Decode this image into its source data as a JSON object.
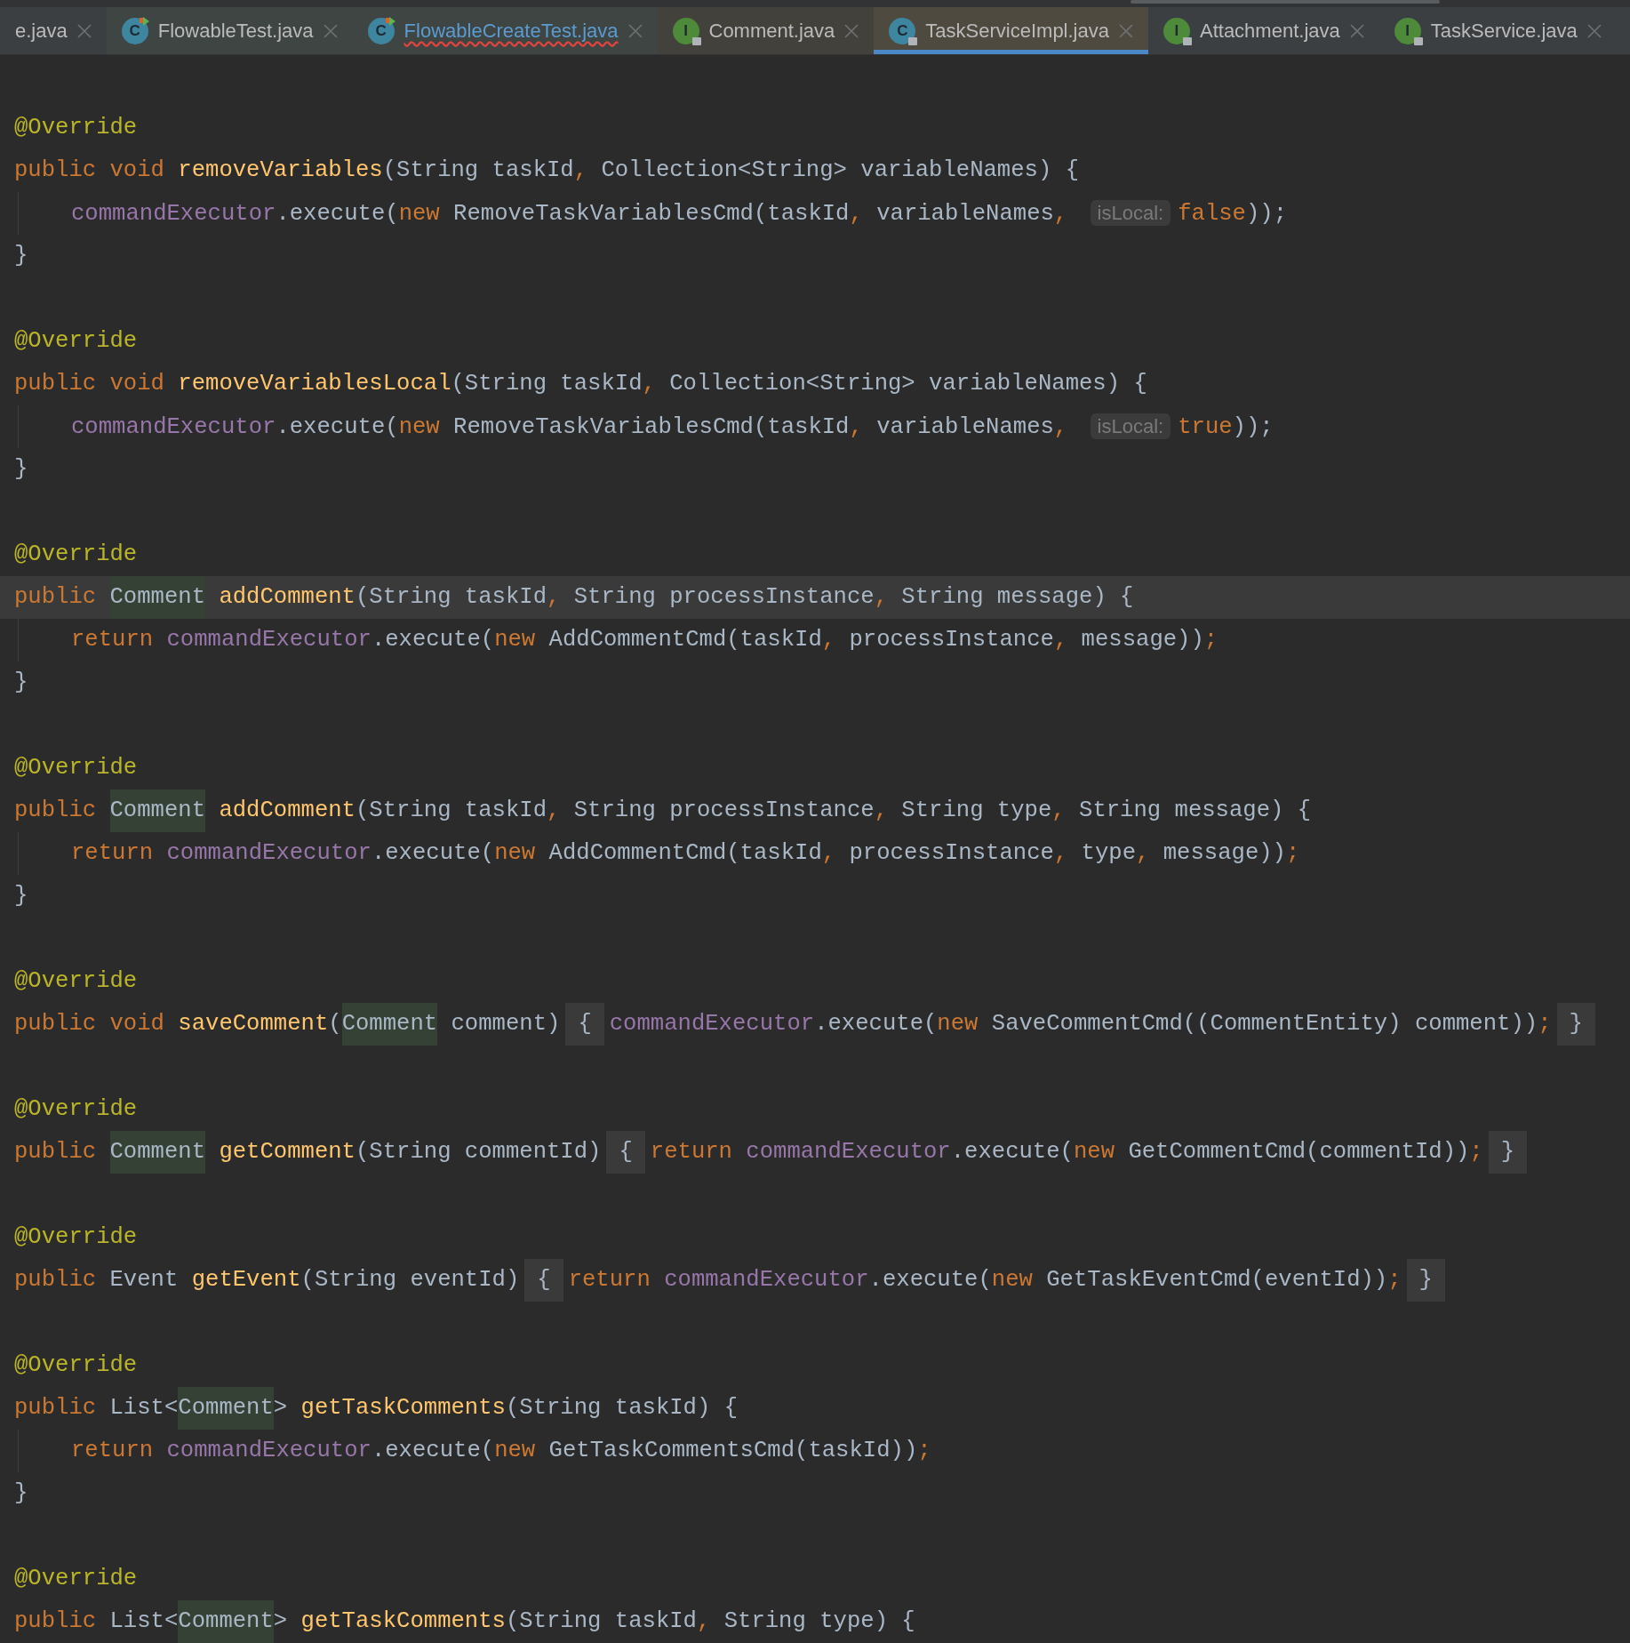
{
  "tabs": [
    {
      "label": "e.java",
      "color": "#3c3f41",
      "selected": false,
      "error": false
    },
    {
      "label": "FlowableTest.java",
      "letter": "C",
      "kind": "test",
      "color": "#3e4542",
      "selected": false,
      "error": false
    },
    {
      "label": "FlowableCreateTest.java",
      "letter": "C",
      "kind": "test",
      "color": "#3e4542",
      "selected": false,
      "error": true
    },
    {
      "label": "Comment.java",
      "letter": "I",
      "kind": "locked-interface",
      "color": "#43413c",
      "selected": false,
      "error": false
    },
    {
      "label": "TaskServiceImpl.java",
      "letter": "C",
      "kind": "locked-class",
      "color": "#4e4a3f",
      "selected": true,
      "error": false
    },
    {
      "label": "Attachment.java",
      "letter": "I",
      "kind": "locked-interface",
      "color": "#3c3f41",
      "selected": false,
      "error": false
    },
    {
      "label": "TaskService.java",
      "letter": "I",
      "kind": "locked-interface",
      "color": "#3c3f41",
      "selected": false,
      "error": false
    }
  ],
  "methods": [
    {
      "lines": [
        {
          "tokens": [
            {
              "text": "@Override",
              "kind": "ann"
            }
          ]
        },
        {
          "tokens": [
            {
              "text": "public void ",
              "kind": "kw"
            },
            {
              "text": "removeVariables",
              "kind": "fn"
            },
            {
              "text": "(String taskId",
              "kind": "plain"
            },
            {
              "text": ", ",
              "kind": "kw"
            },
            {
              "text": "Collection<String> variableNames) {",
              "kind": "plain"
            }
          ]
        },
        {
          "indented": true,
          "tokens": [
            {
              "text": "commandExecutor",
              "kind": "field"
            },
            {
              "text": ".execute(",
              "kind": "plain"
            },
            {
              "text": "new ",
              "kind": "kw"
            },
            {
              "text": "RemoveTaskVariablesCmd(taskId",
              "kind": "plain"
            },
            {
              "text": ", ",
              "kind": "kw"
            },
            {
              "text": "variableNames",
              "kind": "plain"
            },
            {
              "text": ", ",
              "kind": "kw"
            },
            {
              "text": "isLocal:",
              "kind": "hint"
            },
            {
              "text": "false",
              "kind": "kw"
            },
            {
              "text": "));",
              "kind": "plain"
            }
          ]
        },
        {
          "tokens": [
            {
              "text": "}",
              "kind": "plain"
            }
          ]
        }
      ]
    },
    {
      "lines": [
        {
          "tokens": [
            {
              "text": "@Override",
              "kind": "ann"
            }
          ]
        },
        {
          "tokens": [
            {
              "text": "public void ",
              "kind": "kw"
            },
            {
              "text": "removeVariablesLocal",
              "kind": "fn"
            },
            {
              "text": "(String taskId",
              "kind": "plain"
            },
            {
              "text": ", ",
              "kind": "kw"
            },
            {
              "text": "Collection<String> variableNames) {",
              "kind": "plain"
            }
          ]
        },
        {
          "indented": true,
          "tokens": [
            {
              "text": "commandExecutor",
              "kind": "field"
            },
            {
              "text": ".execute(",
              "kind": "plain"
            },
            {
              "text": "new ",
              "kind": "kw"
            },
            {
              "text": "RemoveTaskVariablesCmd(taskId",
              "kind": "plain"
            },
            {
              "text": ", ",
              "kind": "kw"
            },
            {
              "text": "variableNames",
              "kind": "plain"
            },
            {
              "text": ", ",
              "kind": "kw"
            },
            {
              "text": "isLocal:",
              "kind": "hint"
            },
            {
              "text": "true",
              "kind": "kw"
            },
            {
              "text": "));",
              "kind": "plain"
            }
          ]
        },
        {
          "tokens": [
            {
              "text": "}",
              "kind": "plain"
            }
          ]
        }
      ]
    },
    {
      "lines": [
        {
          "tokens": [
            {
              "text": "@Override",
              "kind": "ann"
            }
          ]
        },
        {
          "current": true,
          "tokens": [
            {
              "text": "public ",
              "kind": "kw"
            },
            {
              "text": "Comment",
              "kind": "usage"
            },
            {
              "text": " addComment",
              "kind": "fn"
            },
            {
              "text": "(String taskId",
              "kind": "plain"
            },
            {
              "text": ", ",
              "kind": "kw"
            },
            {
              "text": "String processInstance",
              "kind": "plain"
            },
            {
              "text": ", ",
              "kind": "kw"
            },
            {
              "text": "String message) {",
              "kind": "plain"
            }
          ]
        },
        {
          "indented": true,
          "tokens": [
            {
              "text": "return ",
              "kind": "kw"
            },
            {
              "text": "commandExecutor",
              "kind": "field"
            },
            {
              "text": ".execute(",
              "kind": "plain"
            },
            {
              "text": "new ",
              "kind": "kw"
            },
            {
              "text": "AddCommentCmd(taskId",
              "kind": "plain"
            },
            {
              "text": ", ",
              "kind": "kw"
            },
            {
              "text": "processInstance",
              "kind": "plain"
            },
            {
              "text": ", ",
              "kind": "kw"
            },
            {
              "text": "message))",
              "kind": "plain"
            },
            {
              "text": ";",
              "kind": "kw"
            }
          ]
        },
        {
          "tokens": [
            {
              "text": "}",
              "kind": "plain"
            }
          ]
        }
      ]
    },
    {
      "lines": [
        {
          "tokens": [
            {
              "text": "@Override",
              "kind": "ann"
            }
          ]
        },
        {
          "tokens": [
            {
              "text": "public ",
              "kind": "kw"
            },
            {
              "text": "Comment",
              "kind": "usage"
            },
            {
              "text": " addComment",
              "kind": "fn"
            },
            {
              "text": "(String taskId",
              "kind": "plain"
            },
            {
              "text": ", ",
              "kind": "kw"
            },
            {
              "text": "String processInstance",
              "kind": "plain"
            },
            {
              "text": ", ",
              "kind": "kw"
            },
            {
              "text": "String type",
              "kind": "plain"
            },
            {
              "text": ", ",
              "kind": "kw"
            },
            {
              "text": "String message) {",
              "kind": "plain"
            }
          ]
        },
        {
          "indented": true,
          "tokens": [
            {
              "text": "return ",
              "kind": "kw"
            },
            {
              "text": "commandExecutor",
              "kind": "field"
            },
            {
              "text": ".execute(",
              "kind": "plain"
            },
            {
              "text": "new ",
              "kind": "kw"
            },
            {
              "text": "AddCommentCmd(taskId",
              "kind": "plain"
            },
            {
              "text": ", ",
              "kind": "kw"
            },
            {
              "text": "processInstance",
              "kind": "plain"
            },
            {
              "text": ", ",
              "kind": "kw"
            },
            {
              "text": "type",
              "kind": "plain"
            },
            {
              "text": ", ",
              "kind": "kw"
            },
            {
              "text": "message))",
              "kind": "plain"
            },
            {
              "text": ";",
              "kind": "kw"
            }
          ]
        },
        {
          "tokens": [
            {
              "text": "}",
              "kind": "plain"
            }
          ]
        }
      ]
    },
    {
      "lines": [
        {
          "tokens": [
            {
              "text": "@Override",
              "kind": "ann"
            }
          ]
        },
        {
          "tokens": [
            {
              "text": "public void ",
              "kind": "kw"
            },
            {
              "text": "saveComment",
              "kind": "fn"
            },
            {
              "text": "(",
              "kind": "plain"
            },
            {
              "text": "Comment",
              "kind": "usage"
            },
            {
              "text": " comment)",
              "kind": "plain"
            },
            {
              "text": "{",
              "kind": "fold"
            },
            {
              "text": "commandExecutor",
              "kind": "field"
            },
            {
              "text": ".execute(",
              "kind": "plain"
            },
            {
              "text": "new ",
              "kind": "kw"
            },
            {
              "text": "SaveCommentCmd((CommentEntity) comment))",
              "kind": "plain"
            },
            {
              "text": ";",
              "kind": "kw"
            },
            {
              "text": "}",
              "kind": "fold"
            }
          ]
        }
      ]
    },
    {
      "lines": [
        {
          "tokens": [
            {
              "text": "@Override",
              "kind": "ann"
            }
          ]
        },
        {
          "tokens": [
            {
              "text": "public ",
              "kind": "kw"
            },
            {
              "text": "Comment",
              "kind": "usage"
            },
            {
              "text": " getComment",
              "kind": "fn"
            },
            {
              "text": "(String commentId)",
              "kind": "plain"
            },
            {
              "text": "{",
              "kind": "fold"
            },
            {
              "text": "return ",
              "kind": "kw"
            },
            {
              "text": "commandExecutor",
              "kind": "field"
            },
            {
              "text": ".execute(",
              "kind": "plain"
            },
            {
              "text": "new ",
              "kind": "kw"
            },
            {
              "text": "GetCommentCmd(commentId))",
              "kind": "plain"
            },
            {
              "text": ";",
              "kind": "kw"
            },
            {
              "text": "}",
              "kind": "fold"
            }
          ]
        }
      ]
    },
    {
      "lines": [
        {
          "tokens": [
            {
              "text": "@Override",
              "kind": "ann"
            }
          ]
        },
        {
          "tokens": [
            {
              "text": "public ",
              "kind": "kw"
            },
            {
              "text": "Event ",
              "kind": "plain"
            },
            {
              "text": "getEvent",
              "kind": "fn"
            },
            {
              "text": "(String eventId)",
              "kind": "plain"
            },
            {
              "text": "{",
              "kind": "fold"
            },
            {
              "text": "return ",
              "kind": "kw"
            },
            {
              "text": "commandExecutor",
              "kind": "field"
            },
            {
              "text": ".execute(",
              "kind": "plain"
            },
            {
              "text": "new ",
              "kind": "kw"
            },
            {
              "text": "GetTaskEventCmd(eventId))",
              "kind": "plain"
            },
            {
              "text": ";",
              "kind": "kw"
            },
            {
              "text": "}",
              "kind": "fold"
            }
          ]
        }
      ]
    },
    {
      "lines": [
        {
          "tokens": [
            {
              "text": "@Override",
              "kind": "ann"
            }
          ]
        },
        {
          "tokens": [
            {
              "text": "public ",
              "kind": "kw"
            },
            {
              "text": "List<",
              "kind": "plain"
            },
            {
              "text": "Comment",
              "kind": "usage"
            },
            {
              "text": "> ",
              "kind": "plain"
            },
            {
              "text": "getTaskComments",
              "kind": "fn"
            },
            {
              "text": "(String taskId) {",
              "kind": "plain"
            }
          ]
        },
        {
          "indented": true,
          "tokens": [
            {
              "text": "return ",
              "kind": "kw"
            },
            {
              "text": "commandExecutor",
              "kind": "field"
            },
            {
              "text": ".execute(",
              "kind": "plain"
            },
            {
              "text": "new ",
              "kind": "kw"
            },
            {
              "text": "GetTaskCommentsCmd(taskId))",
              "kind": "plain"
            },
            {
              "text": ";",
              "kind": "kw"
            }
          ]
        },
        {
          "tokens": [
            {
              "text": "}",
              "kind": "plain"
            }
          ]
        }
      ]
    },
    {
      "lines": [
        {
          "tokens": [
            {
              "text": "@Override",
              "kind": "ann"
            }
          ]
        },
        {
          "tokens": [
            {
              "text": "public ",
              "kind": "kw"
            },
            {
              "text": "List<",
              "kind": "plain"
            },
            {
              "text": "Comment",
              "kind": "usage"
            },
            {
              "text": "> ",
              "kind": "plain"
            },
            {
              "text": "getTaskComments",
              "kind": "fn"
            },
            {
              "text": "(String taskId",
              "kind": "plain"
            },
            {
              "text": ", ",
              "kind": "kw"
            },
            {
              "text": "String type) {",
              "kind": "plain"
            }
          ]
        }
      ]
    }
  ]
}
